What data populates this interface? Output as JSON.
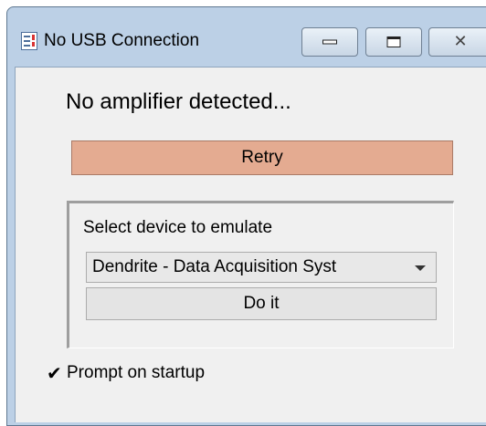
{
  "window": {
    "title": "No USB Connection",
    "app_icon": "settings-app-icon",
    "controls": {
      "minimize_icon": "minimize-icon",
      "maximize_icon": "maximize-icon",
      "close_icon": "close-icon",
      "close_glyph": "✕"
    }
  },
  "main": {
    "status_message": "No amplifier detected...",
    "retry_label": "Retry",
    "emulate_group": {
      "label": "Select device to emulate",
      "selected_device": "Dendrite - Data Acquisition Syst",
      "dropdown_icon": "chevron-down-icon",
      "do_it_label": "Do it"
    },
    "prompt_on_startup": {
      "label": "Prompt on startup",
      "checked": true,
      "check_glyph": "✔"
    }
  },
  "colors": {
    "retry_button": "#e4ab91",
    "title_bar": "#bcd0e6",
    "client_background": "#f0f0f0"
  }
}
